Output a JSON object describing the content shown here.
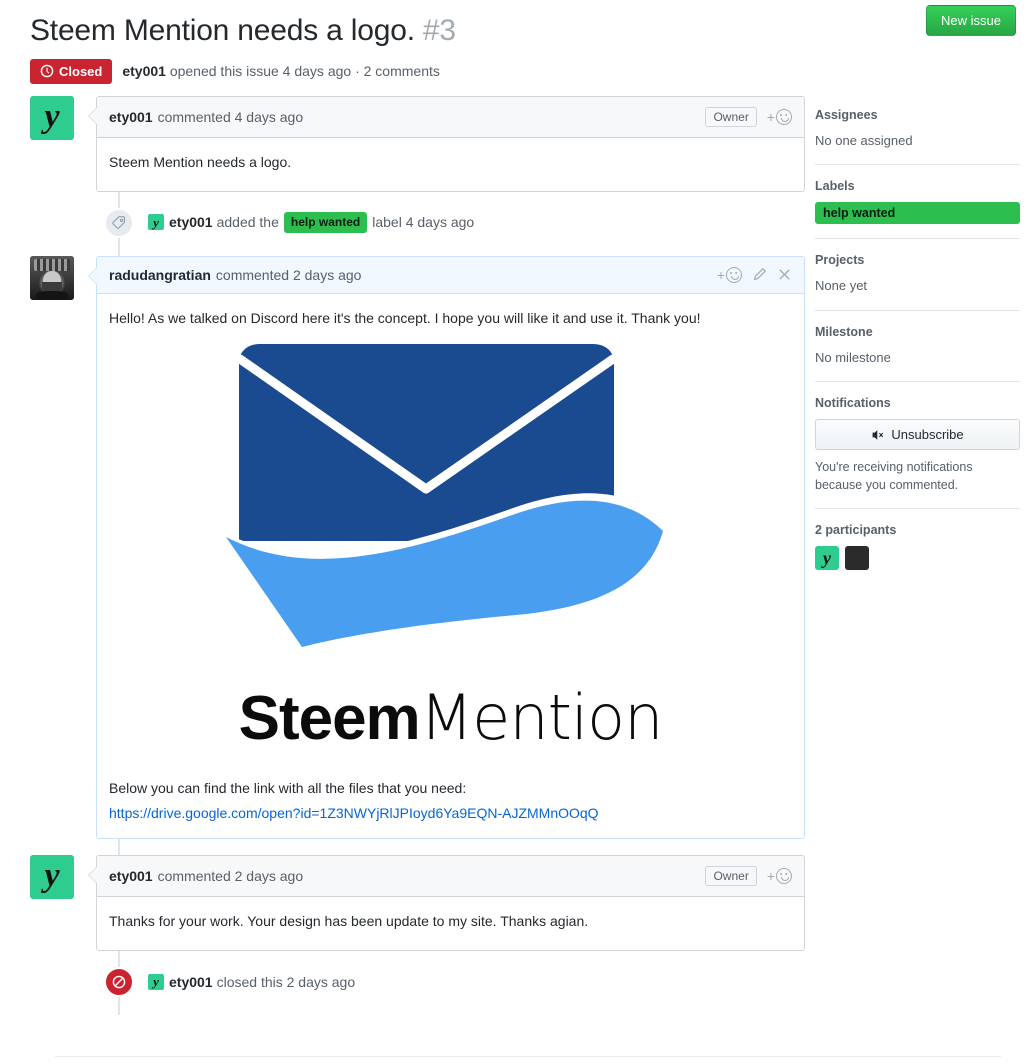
{
  "header": {
    "title": "Steem Mention needs a logo.",
    "issue_number": "#3",
    "new_issue_label": "New issue",
    "state": "Closed",
    "meta_author": "ety001",
    "meta_text": " opened this issue 4 days ago · 2 comments"
  },
  "timeline": {
    "comment1": {
      "author": "ety001",
      "meta": "commented 4 days ago",
      "owner_chip": "Owner",
      "body": "Steem Mention needs a logo.",
      "avatar_letter": "y"
    },
    "label_event": {
      "icon": "tag-icon",
      "actor": "ety001",
      "pre_text": "added the",
      "label": "help wanted",
      "post_text": "label 4 days ago",
      "avatar_letter": "y"
    },
    "comment2": {
      "author": "radudangratian",
      "meta": "commented 2 days ago",
      "body": "Hello! As we talked on Discord here it's the concept. I hope you will like it and use it. Thank you!",
      "wordmark_bold": "Steem",
      "wordmark_thin": "Mention",
      "below_text": "Below you can find the link with all the files that you need:",
      "link_text": "https://drive.google.com/open?id=1Z3NWYjRlJPIoyd6Ya9EQN-AJZMMnOOqQ"
    },
    "comment3": {
      "author": "ety001",
      "meta": "commented 2 days ago",
      "owner_chip": "Owner",
      "body": "Thanks for your work. Your design has been update to my site. Thanks agian.",
      "avatar_letter": "y"
    },
    "closed_event": {
      "icon": "issue-closed-icon",
      "actor": "ety001",
      "text": "closed this 2 days ago",
      "avatar_letter": "y"
    }
  },
  "sidebar": {
    "assignees": {
      "title": "Assignees",
      "value": "No one assigned"
    },
    "labels": {
      "title": "Labels",
      "chip": "help wanted"
    },
    "projects": {
      "title": "Projects",
      "value": "None yet"
    },
    "milestone": {
      "title": "Milestone",
      "value": "No milestone"
    },
    "notifications": {
      "title": "Notifications",
      "button": "Unsubscribe",
      "note": "You're receiving notifications because you commented."
    },
    "participants": {
      "title": "2 participants",
      "avatar1_letter": "y"
    }
  },
  "colors": {
    "green_button": "#28a745",
    "label_green": "#2cbe4e",
    "closed_red": "#cb2431",
    "link_blue": "#0366d6",
    "avatar_green": "#2ecc8f",
    "logo_dark_blue": "#1a4a8f",
    "logo_light_blue": "#4a9ef0"
  }
}
